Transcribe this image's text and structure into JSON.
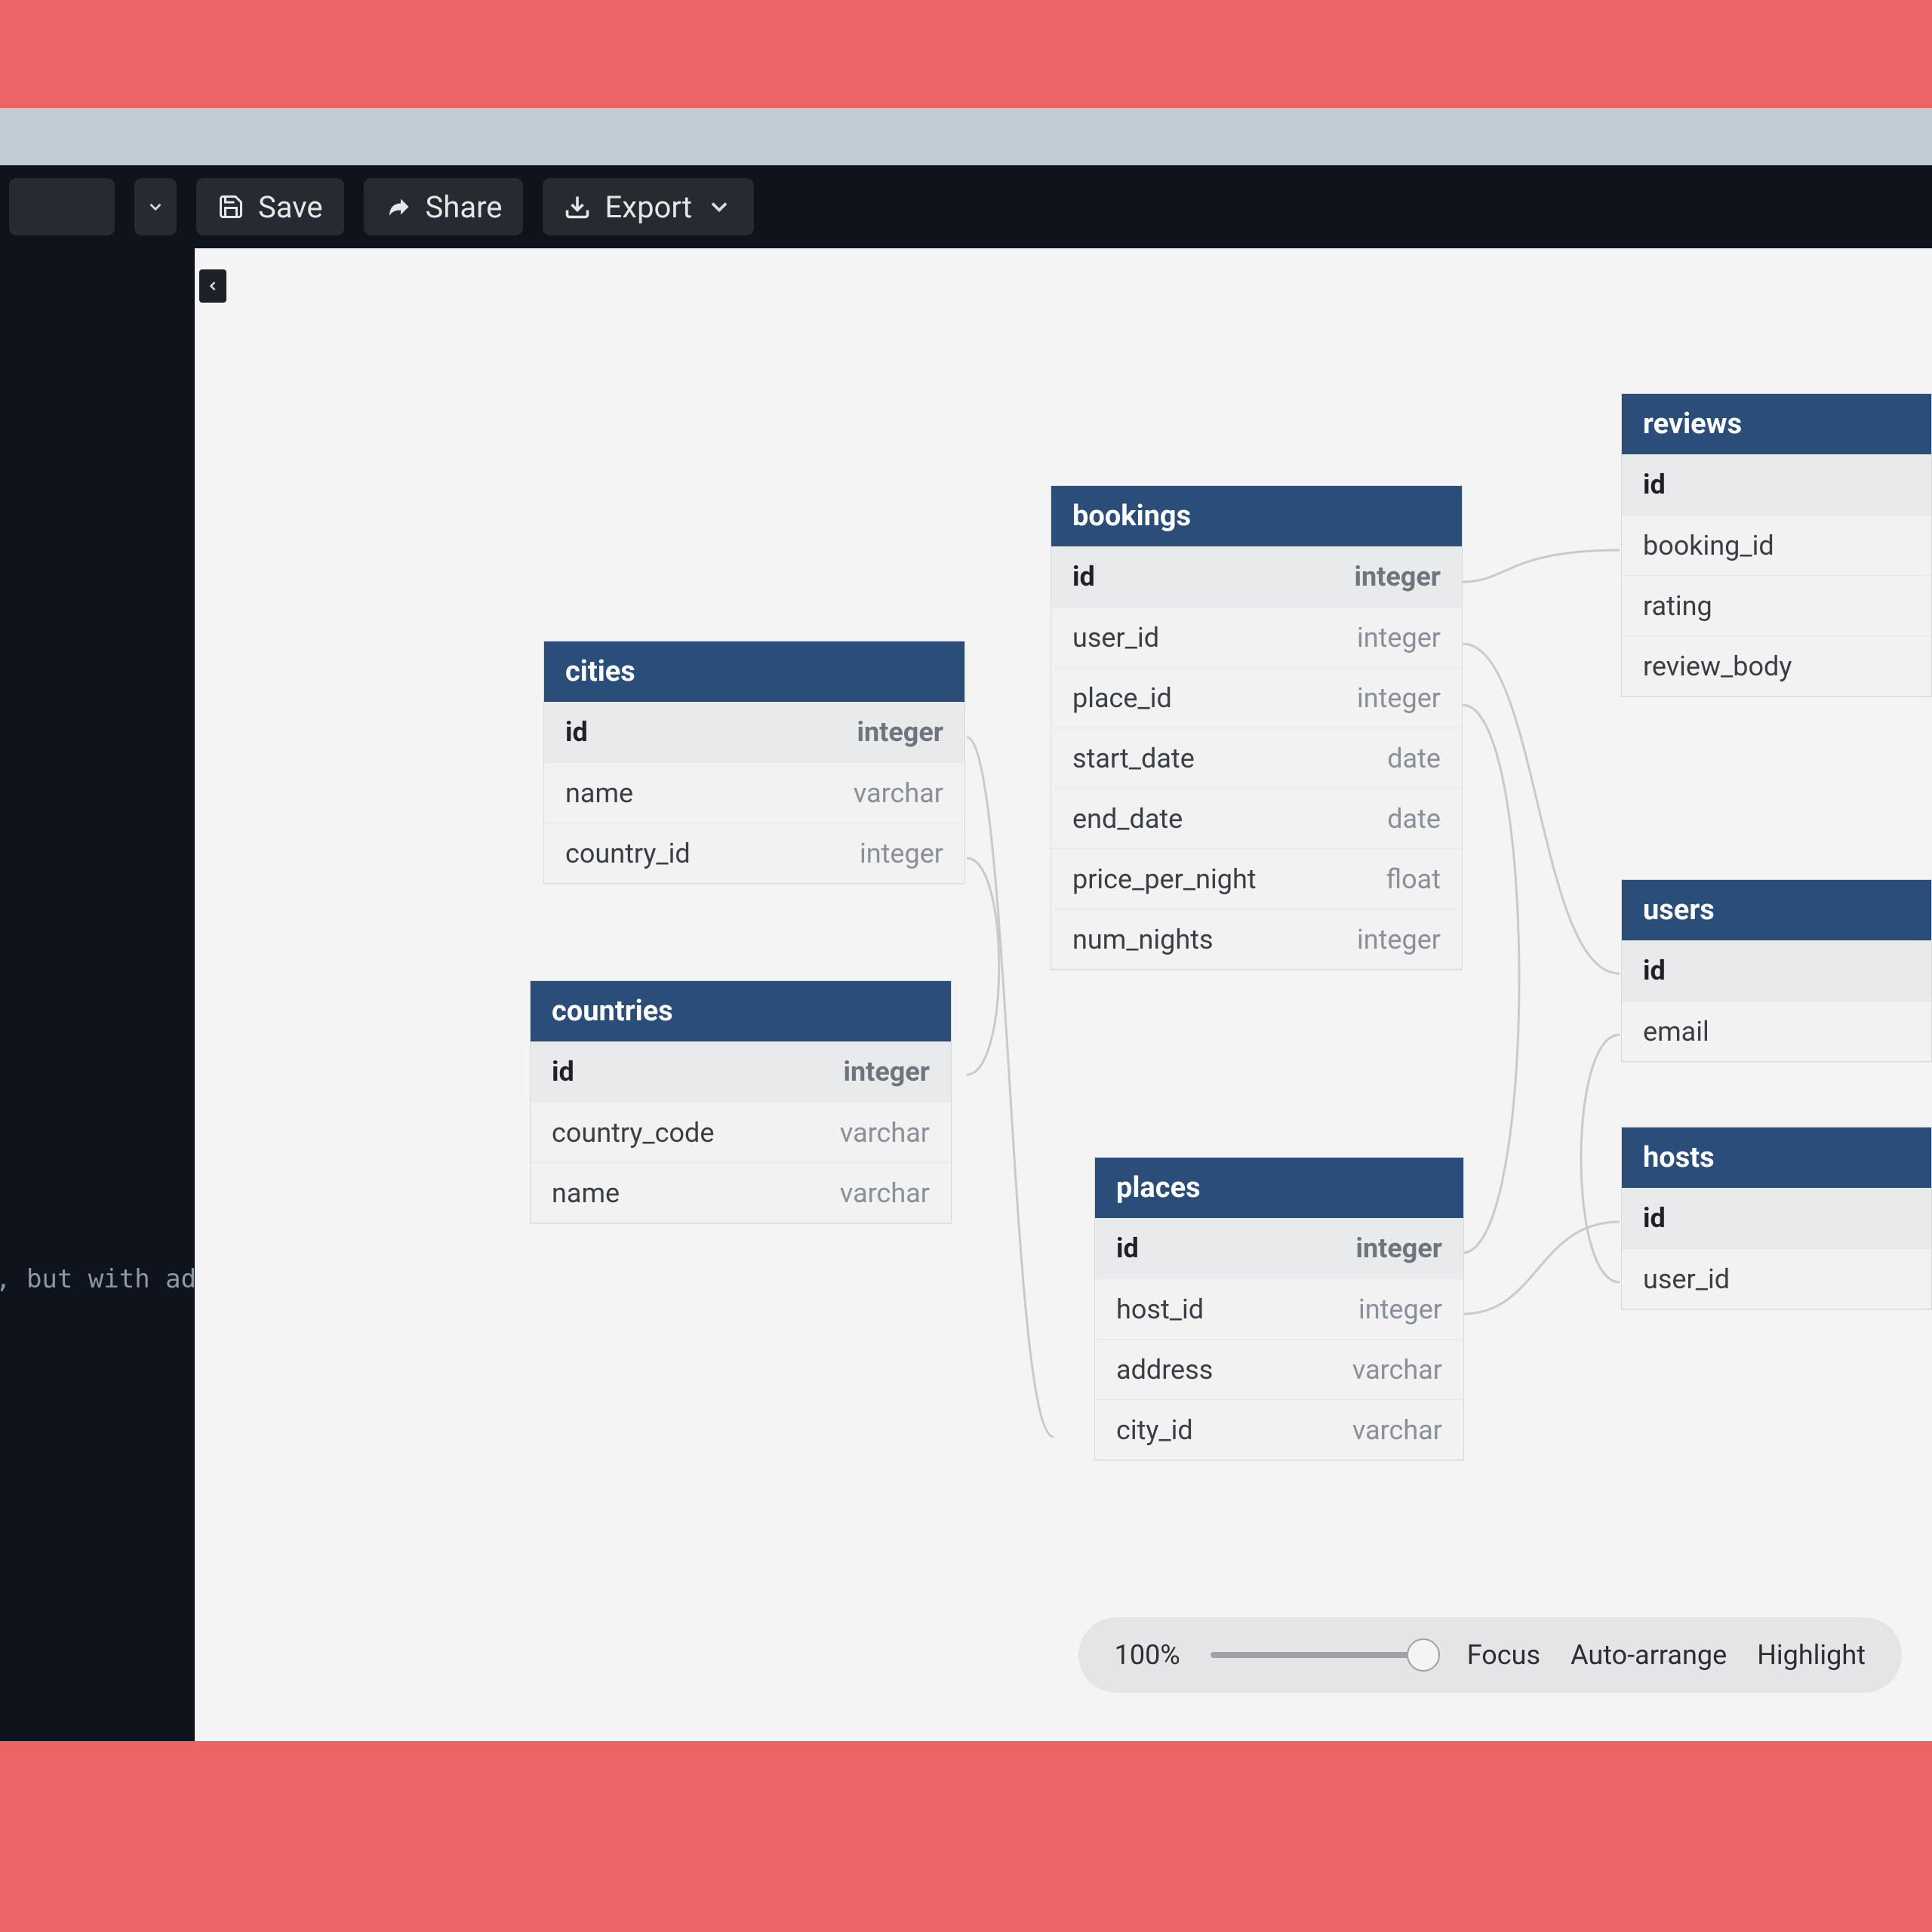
{
  "toolbar": {
    "save_label": "Save",
    "share_label": "Share",
    "export_label": "Export"
  },
  "editor": {
    "visible_snippet": ", but with ad"
  },
  "tables": {
    "cities": {
      "title": "cities",
      "cols": [
        {
          "name": "id",
          "type": "integer",
          "hl": true
        },
        {
          "name": "name",
          "type": "varchar",
          "hl": false
        },
        {
          "name": "country_id",
          "type": "integer",
          "hl": false
        }
      ]
    },
    "countries": {
      "title": "countries",
      "cols": [
        {
          "name": "id",
          "type": "integer",
          "hl": true
        },
        {
          "name": "country_code",
          "type": "varchar",
          "hl": false
        },
        {
          "name": "name",
          "type": "varchar",
          "hl": false
        }
      ]
    },
    "bookings": {
      "title": "bookings",
      "cols": [
        {
          "name": "id",
          "type": "integer",
          "hl": true
        },
        {
          "name": "user_id",
          "type": "integer",
          "hl": false
        },
        {
          "name": "place_id",
          "type": "integer",
          "hl": false
        },
        {
          "name": "start_date",
          "type": "date",
          "hl": false
        },
        {
          "name": "end_date",
          "type": "date",
          "hl": false
        },
        {
          "name": "price_per_night",
          "type": "float",
          "hl": false
        },
        {
          "name": "num_nights",
          "type": "integer",
          "hl": false
        }
      ]
    },
    "places": {
      "title": "places",
      "cols": [
        {
          "name": "id",
          "type": "integer",
          "hl": true
        },
        {
          "name": "host_id",
          "type": "integer",
          "hl": false
        },
        {
          "name": "address",
          "type": "varchar",
          "hl": false
        },
        {
          "name": "city_id",
          "type": "varchar",
          "hl": false
        }
      ]
    },
    "reviews": {
      "title": "reviews",
      "cols": [
        {
          "name": "id",
          "type": "",
          "hl": true
        },
        {
          "name": "booking_id",
          "type": "",
          "hl": false
        },
        {
          "name": "rating",
          "type": "",
          "hl": false
        },
        {
          "name": "review_body",
          "type": "",
          "hl": false
        }
      ]
    },
    "users": {
      "title": "users",
      "cols": [
        {
          "name": "id",
          "type": "",
          "hl": true
        },
        {
          "name": "email",
          "type": "",
          "hl": false
        }
      ]
    },
    "hosts": {
      "title": "hosts",
      "cols": [
        {
          "name": "id",
          "type": "",
          "hl": true
        },
        {
          "name": "user_id",
          "type": "",
          "hl": false
        }
      ]
    }
  },
  "footer": {
    "zoom_label": "100%",
    "focus_label": "Focus",
    "auto_arrange_label": "Auto-arrange",
    "highlight_label": "Highlight"
  }
}
